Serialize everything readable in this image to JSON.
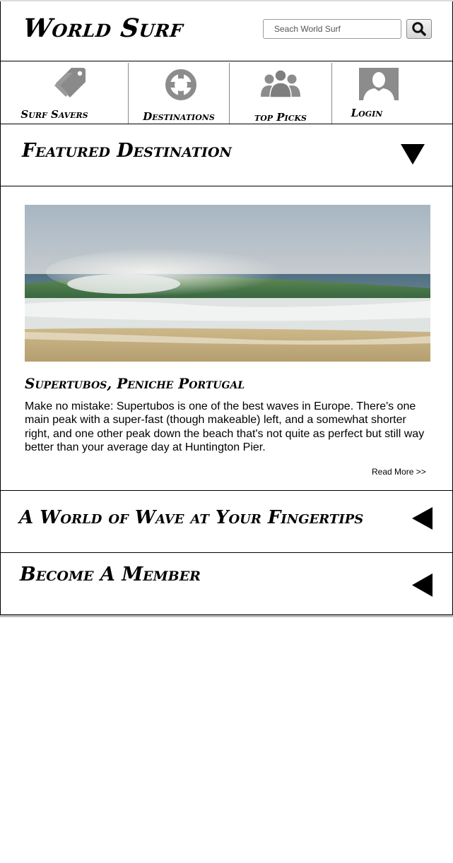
{
  "header": {
    "brand": "World Surf",
    "search_placeholder": "Seach World Surf",
    "search_button_icon": "search-icon"
  },
  "nav": {
    "items": [
      {
        "label": "Surf Savers",
        "icon": "tag-icon"
      },
      {
        "label": "Destinations",
        "icon": "crosshair-icon"
      },
      {
        "label": "top Picks",
        "icon": "people-icon"
      },
      {
        "label": "Login",
        "icon": "user-avatar-icon"
      }
    ]
  },
  "featured": {
    "title": "Featured Destination",
    "toggle_icon": "triangle-down-icon",
    "destination_name": "Supertubos, Peniche Portugal",
    "description": "Make no mistake: Supertubos is one of the best waves in Europe. There's one main peak with a super-fast (though makeable) left, and a somewhat shorter right, and one other peak down the beach that's not quite as perfect but still way better than your average day at Huntington Pier.",
    "read_more": "Read More >>"
  },
  "sections": [
    {
      "title": "A World of Wave at Your Fingertips",
      "toggle_icon": "triangle-left-icon"
    },
    {
      "title": "Become A Member",
      "toggle_icon": "triangle-left-icon"
    }
  ]
}
